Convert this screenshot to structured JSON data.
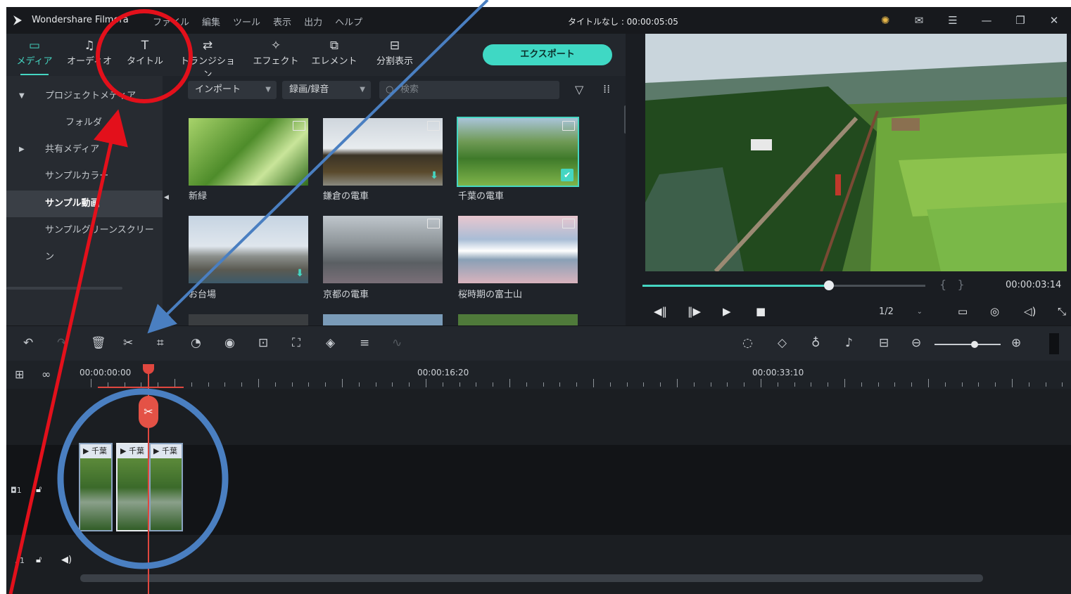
{
  "titlebar": {
    "app_name": "Wondershare Filmora",
    "menu": [
      "ファイル",
      "編集",
      "ツール",
      "表示",
      "出力",
      "ヘルプ"
    ],
    "doc_title": "タイトルなし : 00:00:05:05"
  },
  "tools": [
    {
      "label": "メディア",
      "icon": "folder-icon"
    },
    {
      "label": "オーディオ",
      "icon": "music-note-icon"
    },
    {
      "label": "タイトル",
      "icon": "text-icon"
    },
    {
      "label": "トランジション",
      "icon": "transition-icon"
    },
    {
      "label": "エフェクト",
      "icon": "effect-icon"
    },
    {
      "label": "エレメント",
      "icon": "element-icon"
    },
    {
      "label": "分割表示",
      "icon": "split-screen-icon"
    }
  ],
  "export_label": "エクスポート",
  "sidebar": {
    "items": [
      {
        "label": "プロジェクトメディア",
        "arrow": "▼"
      },
      {
        "label": "フォルダ",
        "arrow": ""
      },
      {
        "label": "共有メディア",
        "arrow": "▶"
      },
      {
        "label": "サンプルカラー",
        "arrow": ""
      },
      {
        "label": "サンプル動画",
        "arrow": ""
      },
      {
        "label": "サンプルグリーンスクリーン",
        "arrow": ""
      }
    ]
  },
  "mediabar": {
    "import_label": "インポート",
    "record_label": "録画/録音",
    "search_placeholder": "検索"
  },
  "media": [
    {
      "label": "新緑"
    },
    {
      "label": "鎌倉の電車"
    },
    {
      "label": "千葉の電車"
    },
    {
      "label": "お台場"
    },
    {
      "label": "京都の電車"
    },
    {
      "label": "桜時期の富士山"
    }
  ],
  "preview": {
    "time": "00:00:03:14",
    "ratio": "1/2",
    "progress": 0.66
  },
  "ruler": {
    "labels": [
      "00:00:00:00",
      "00:00:16:20",
      "00:00:33:10"
    ]
  },
  "clips": [
    {
      "label": "千葉"
    },
    {
      "label": "千葉"
    },
    {
      "label": "千葉"
    }
  ],
  "colors": {
    "accent": "#45d6c2",
    "annotation_red": "#e3101b",
    "annotation_blue": "#4a7fc1"
  }
}
